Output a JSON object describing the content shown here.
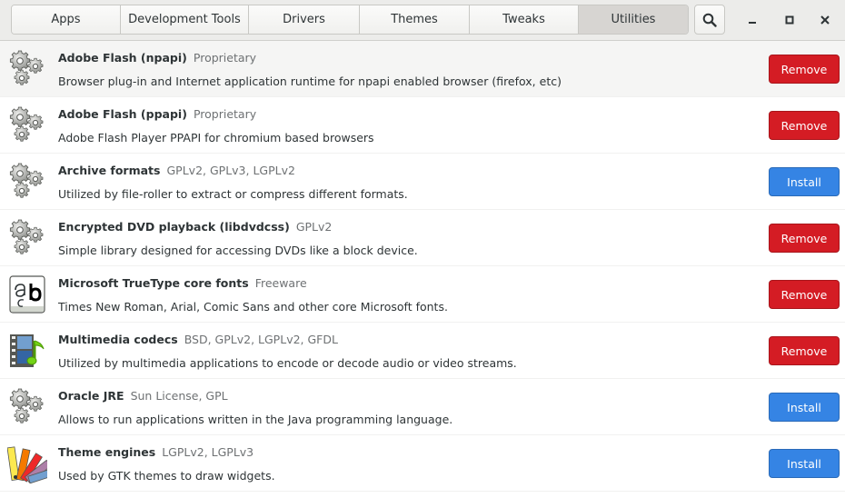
{
  "tabs": [
    {
      "label": "Apps",
      "name": "tab-apps",
      "active": false
    },
    {
      "label": "Development Tools",
      "name": "tab-development-tools",
      "active": false
    },
    {
      "label": "Drivers",
      "name": "tab-drivers",
      "active": false
    },
    {
      "label": "Themes",
      "name": "tab-themes",
      "active": false
    },
    {
      "label": "Tweaks",
      "name": "tab-tweaks",
      "active": false
    },
    {
      "label": "Utilities",
      "name": "tab-utilities",
      "active": true
    }
  ],
  "icons": {
    "search": "search-icon",
    "minimize": "minimize-icon",
    "maximize": "maximize-icon",
    "close": "close-icon"
  },
  "colors": {
    "remove": "#d41c24",
    "install": "#3584e4"
  },
  "items": [
    {
      "title": "Adobe Flash (npapi)",
      "license": "Proprietary",
      "description": "Browser plug-in and Internet application runtime for npapi enabled browser (firefox, etc)",
      "action": "Remove",
      "icon": "gears-icon"
    },
    {
      "title": "Adobe Flash (ppapi)",
      "license": "Proprietary",
      "description": "Adobe Flash Player PPAPI for chromium based browsers",
      "action": "Remove",
      "icon": "gears-icon"
    },
    {
      "title": "Archive formats",
      "license": "GPLv2, GPLv3, LGPLv2",
      "description": "Utilized by file-roller to extract or compress different formats.",
      "action": "Install",
      "icon": "gears-icon"
    },
    {
      "title": "Encrypted DVD playback (libdvdcss)",
      "license": "GPLv2",
      "description": "Simple library designed for accessing DVDs like a block device.",
      "action": "Remove",
      "icon": "gears-icon"
    },
    {
      "title": "Microsoft TrueType core fonts",
      "license": "Freeware",
      "description": "Times New Roman, Arial, Comic Sans and other core Microsoft fonts.",
      "action": "Remove",
      "icon": "font-icon"
    },
    {
      "title": "Multimedia codecs",
      "license": "BSD, GPLv2, LGPLv2, GFDL",
      "description": "Utilized by multimedia applications to encode or decode audio or video streams.",
      "action": "Remove",
      "icon": "multimedia-icon"
    },
    {
      "title": "Oracle JRE",
      "license": "Sun License, GPL",
      "description": "Allows to run applications written in the Java programming language.",
      "action": "Install",
      "icon": "gears-icon"
    },
    {
      "title": "Theme engines",
      "license": "LGPLv2, LGPLv3",
      "description": "Used by GTK themes to draw widgets.",
      "action": "Install",
      "icon": "palette-icon"
    }
  ]
}
